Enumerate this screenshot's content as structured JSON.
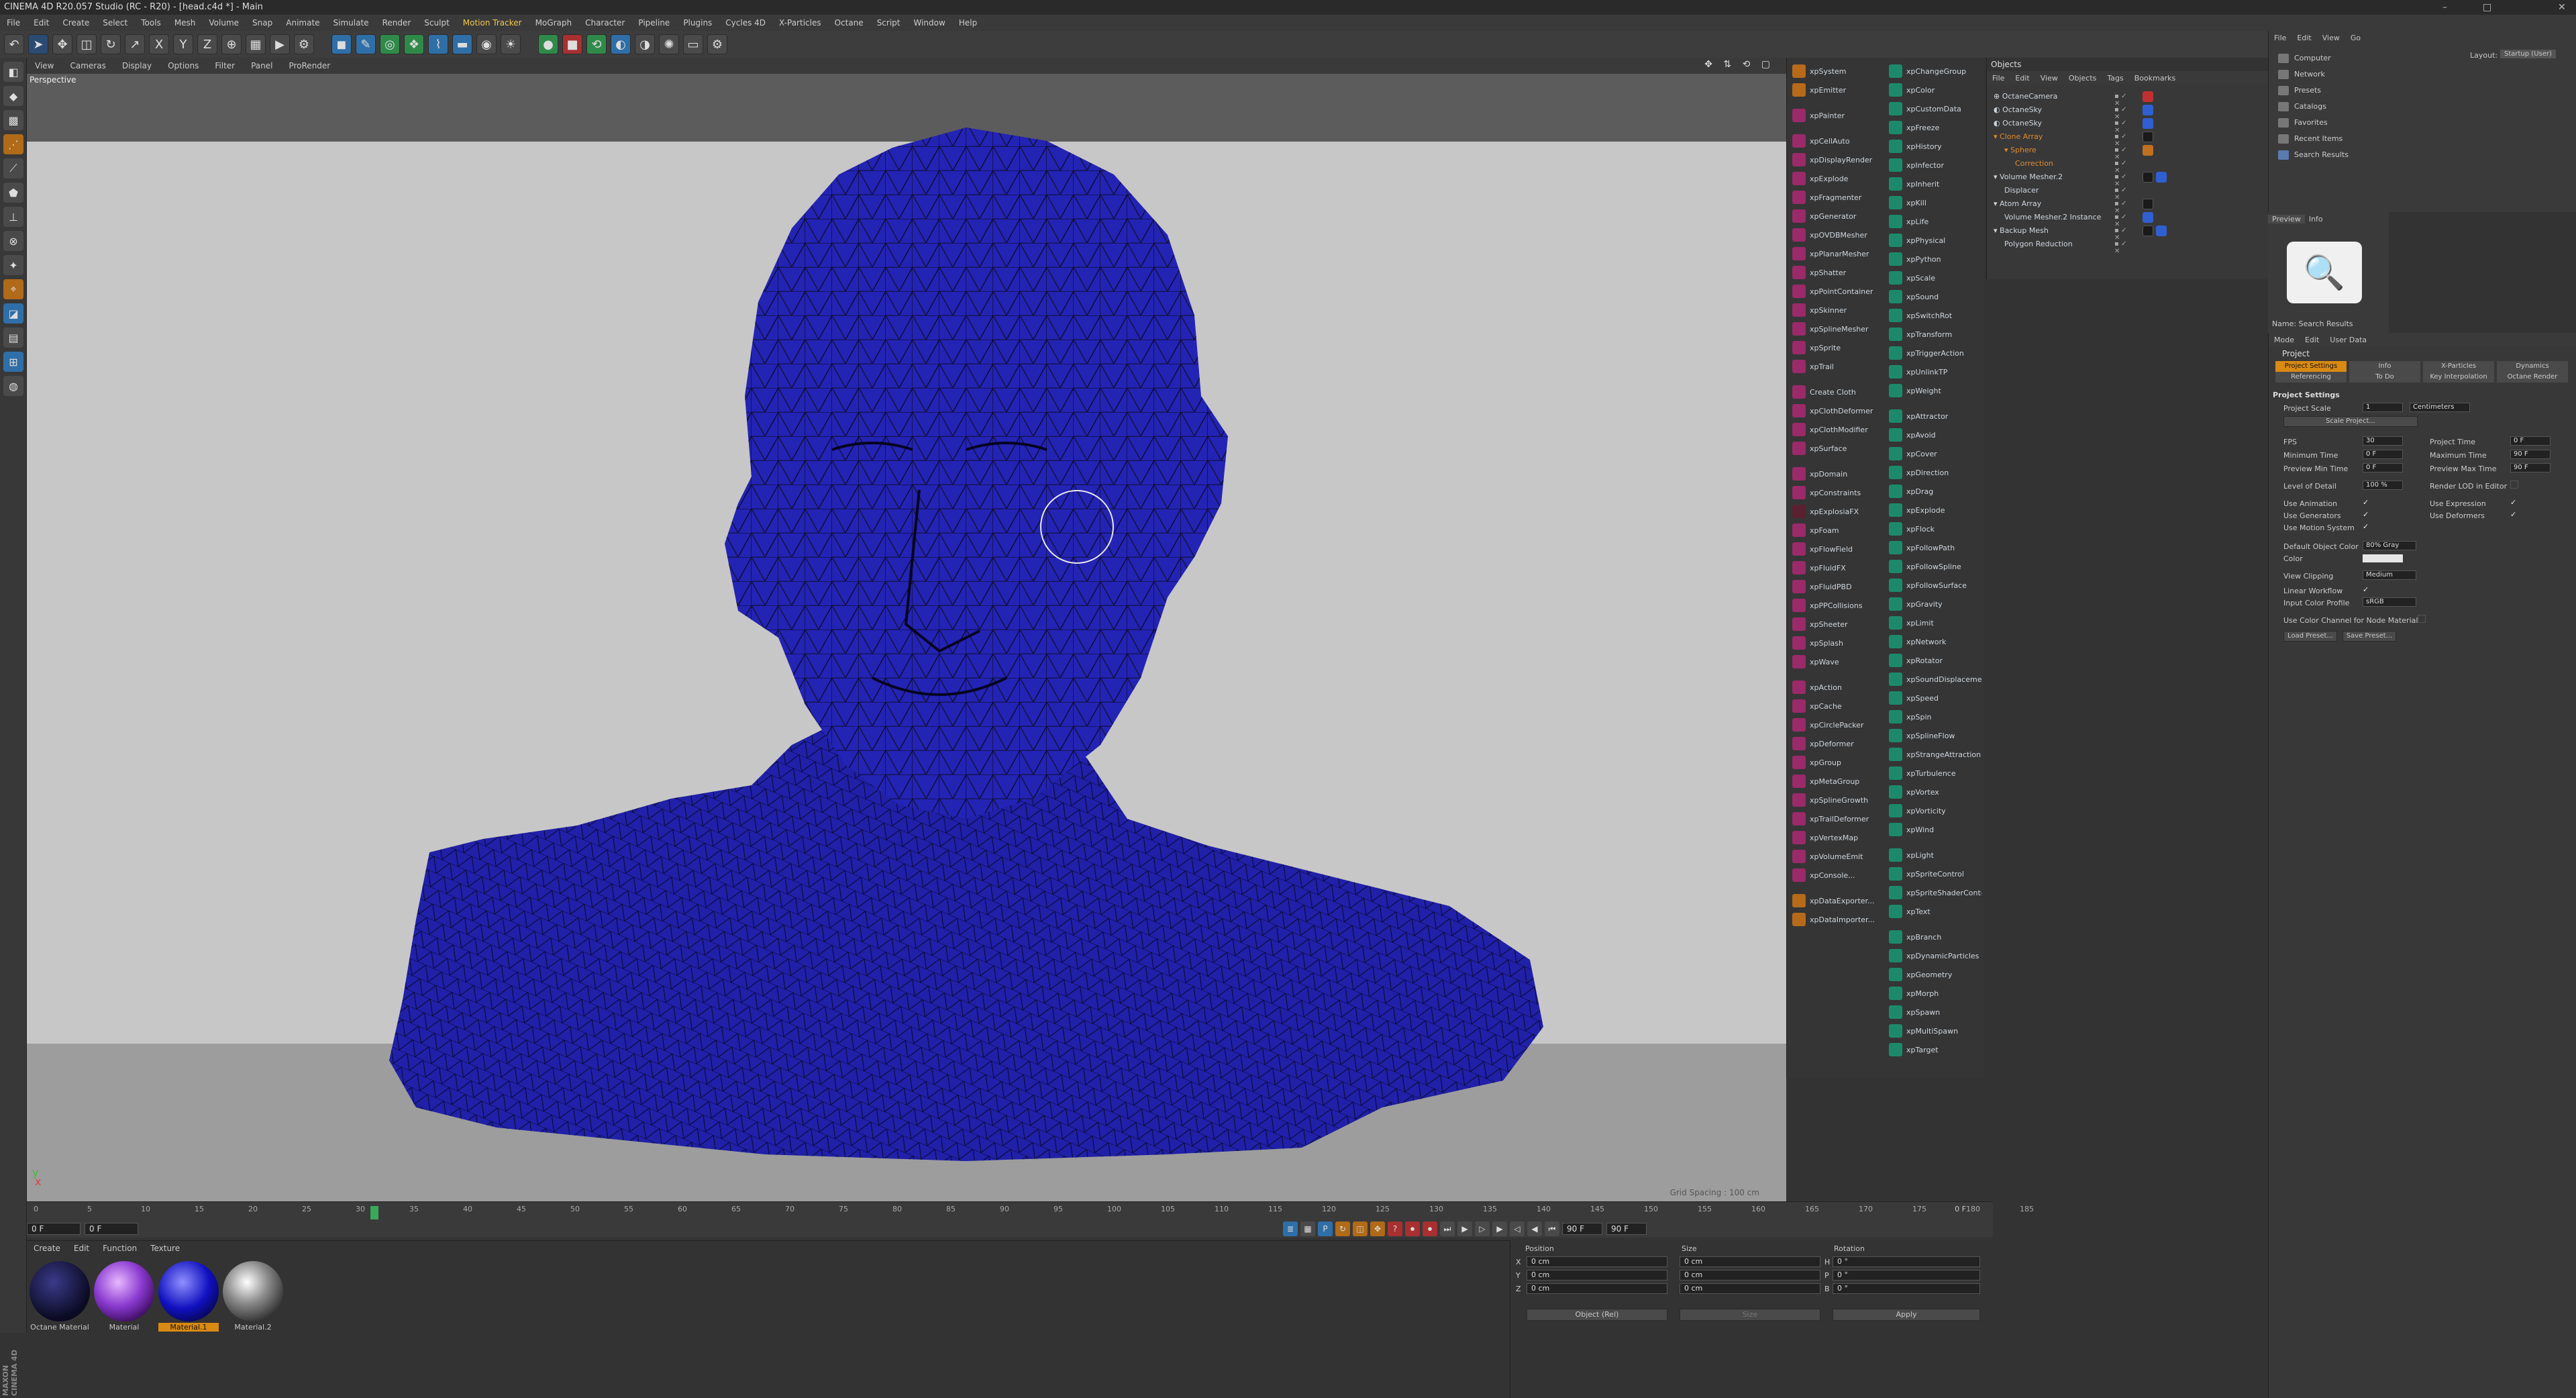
{
  "window": {
    "title": "CINEMA 4D R20.057 Studio (RC - R20) - [head.c4d *] - Main",
    "controls": [
      "–",
      "□",
      "✕"
    ]
  },
  "menu": [
    {
      "label": "File"
    },
    {
      "label": "Edit"
    },
    {
      "label": "Create"
    },
    {
      "label": "Select"
    },
    {
      "label": "Tools"
    },
    {
      "label": "Mesh"
    },
    {
      "label": "Volume"
    },
    {
      "label": "Snap"
    },
    {
      "label": "Animate"
    },
    {
      "label": "Simulate"
    },
    {
      "label": "Render"
    },
    {
      "label": "Sculpt"
    },
    {
      "label": "Motion Tracker",
      "hl": true
    },
    {
      "label": "MoGraph"
    },
    {
      "label": "Character"
    },
    {
      "label": "Pipeline"
    },
    {
      "label": "Plugins"
    },
    {
      "label": "Cycles 4D"
    },
    {
      "label": "X-Particles"
    },
    {
      "label": "Octane"
    },
    {
      "label": "Script"
    },
    {
      "label": "Window"
    },
    {
      "label": "Help"
    }
  ],
  "toolbar": [
    {
      "name": "undo-icon",
      "icon": "↶",
      "c": ""
    },
    {
      "name": "select-arrow-icon",
      "icon": "➤",
      "c": "sel"
    },
    {
      "name": "move-icon",
      "icon": "✥",
      "c": ""
    },
    {
      "name": "scale-icon",
      "icon": "◫",
      "c": ""
    },
    {
      "name": "rotate-icon",
      "icon": "↻",
      "c": ""
    },
    {
      "name": "recent-tool-icon",
      "icon": "↗",
      "c": ""
    },
    {
      "name": "x-axis-icon",
      "icon": "X",
      "c": ""
    },
    {
      "name": "y-axis-icon",
      "icon": "Y",
      "c": ""
    },
    {
      "name": "z-axis-icon",
      "icon": "Z",
      "c": ""
    },
    {
      "name": "coord-system-icon",
      "icon": "⊕",
      "c": ""
    },
    {
      "name": "render-region-icon",
      "icon": "▦",
      "c": ""
    },
    {
      "name": "render-view-icon",
      "icon": "▶",
      "c": ""
    },
    {
      "name": "render-settings-icon",
      "icon": "⚙",
      "c": ""
    },
    {
      "name": "cube-icon",
      "icon": "◼",
      "c": "blue"
    },
    {
      "name": "spline-pen-icon",
      "icon": "✎",
      "c": "blue"
    },
    {
      "name": "nurbs-icon",
      "icon": "◎",
      "c": "green"
    },
    {
      "name": "array-icon",
      "icon": "❖",
      "c": "green"
    },
    {
      "name": "deformer-icon",
      "icon": "⌇",
      "c": "blue"
    },
    {
      "name": "scene-floor-icon",
      "icon": "▬",
      "c": "blue"
    },
    {
      "name": "camera-icon",
      "icon": "◉",
      "c": ""
    },
    {
      "name": "light-icon",
      "icon": "☀",
      "c": ""
    },
    {
      "name": "octane-live-icon",
      "icon": "●",
      "c": "green"
    },
    {
      "name": "octane-stop-icon",
      "icon": "■",
      "c": "red"
    },
    {
      "name": "octane-refresh-icon",
      "icon": "⟲",
      "c": "green"
    },
    {
      "name": "octane-material-icon",
      "icon": "◐",
      "c": "blue"
    },
    {
      "name": "octane-env-icon",
      "icon": "◑",
      "c": ""
    },
    {
      "name": "octane-sun-icon",
      "icon": "✺",
      "c": ""
    },
    {
      "name": "octane-screen-icon",
      "icon": "▭",
      "c": ""
    },
    {
      "name": "octane-settings-icon",
      "icon": "⚙",
      "c": ""
    }
  ],
  "left_tools": [
    {
      "name": "make-editable-icon",
      "icon": "◧",
      "c": ""
    },
    {
      "name": "model-mode-icon",
      "icon": "◆",
      "c": ""
    },
    {
      "name": "texture-mode-icon",
      "icon": "▩",
      "c": ""
    },
    {
      "name": "points-mode-icon",
      "icon": "⋰",
      "c": "orange"
    },
    {
      "name": "edges-mode-icon",
      "icon": "⟋",
      "c": ""
    },
    {
      "name": "polygons-mode-icon",
      "icon": "⬟",
      "c": ""
    },
    {
      "name": "axis-mode-icon",
      "icon": "⊥",
      "c": ""
    },
    {
      "name": "enable-axis-icon",
      "icon": "⊗",
      "c": ""
    },
    {
      "name": "tweak-icon",
      "icon": "✦",
      "c": ""
    },
    {
      "name": "snap-icon",
      "icon": "⌖",
      "c": "orange"
    },
    {
      "name": "workplane-icon",
      "icon": "◪",
      "c": "blue"
    },
    {
      "name": "quantize-icon",
      "icon": "▤",
      "c": ""
    },
    {
      "name": "lock-workplane-icon",
      "icon": "⊞",
      "c": "blue"
    },
    {
      "name": "solo-icon",
      "icon": "◍",
      "c": ""
    }
  ],
  "viewport": {
    "menu": [
      "View",
      "Cameras",
      "Display",
      "Options",
      "Filter",
      "Panel",
      "ProRender"
    ],
    "label": "Perspective",
    "nav": "✥ ⇅ ⟲ ▢",
    "grid_info": "Grid Spacing : 100 cm",
    "axis_x": "x",
    "axis_y": "y"
  },
  "timeline": {
    "ticks": [
      "0",
      "5",
      "10",
      "15",
      "20",
      "25",
      "30",
      "35",
      "40",
      "45",
      "50",
      "55",
      "60",
      "65",
      "70",
      "75",
      "80",
      "85",
      "90",
      "95",
      "100",
      "105",
      "110",
      "115",
      "120",
      "125",
      "130",
      "135",
      "140",
      "145",
      "150",
      "155",
      "160",
      "165",
      "170",
      "175",
      "180",
      "185"
    ],
    "end_label": "0 F",
    "start_field": "0 F",
    "cur_field": "0 F",
    "end_field": "90 F",
    "max_field": "90 F",
    "controls": [
      {
        "name": "goto-start-icon",
        "icon": "⏮",
        "c": ""
      },
      {
        "name": "prev-key-icon",
        "icon": "◀",
        "c": ""
      },
      {
        "name": "prev-frame-icon",
        "icon": "◁",
        "c": ""
      },
      {
        "name": "play-icon",
        "icon": "▶",
        "c": ""
      },
      {
        "name": "next-frame-icon",
        "icon": "▷",
        "c": ""
      },
      {
        "name": "next-key-icon",
        "icon": "▶",
        "c": ""
      },
      {
        "name": "goto-end-icon",
        "icon": "⏭",
        "c": ""
      },
      {
        "name": "record-icon",
        "icon": "⏺",
        "c": "red"
      },
      {
        "name": "autokey-icon",
        "icon": "⏺",
        "c": "red"
      },
      {
        "name": "keyframe-sel-icon",
        "icon": "?",
        "c": "red"
      },
      {
        "name": "pos-key-icon",
        "icon": "✥",
        "c": "orange"
      },
      {
        "name": "scale-key-icon",
        "icon": "◫",
        "c": "orange"
      },
      {
        "name": "rot-key-icon",
        "icon": "↻",
        "c": "orange"
      },
      {
        "name": "param-key-icon",
        "icon": "P",
        "c": "blue"
      },
      {
        "name": "pla-key-icon",
        "icon": "▦",
        "c": ""
      },
      {
        "name": "timeline-icon",
        "icon": "≣",
        "c": "blue"
      }
    ]
  },
  "materials": {
    "menu": [
      "Create",
      "Edit",
      "Function",
      "Texture"
    ],
    "items": [
      {
        "name": "Octane Material",
        "grad": "radial-gradient(circle at 40% 35%,#3a3a8a,#0a0a22 70%)",
        "sel": false
      },
      {
        "name": "Material",
        "grad": "radial-gradient(circle at 40% 35%,#e8b8ff,#8a3ad0 45%,#3a0a5a 80%)",
        "sel": false
      },
      {
        "name": "Material.1",
        "grad": "radial-gradient(circle at 40% 35%,#9090ff,#1010c0 50%,#050540 85%)",
        "sel": true
      },
      {
        "name": "Material.2",
        "grad": "radial-gradient(circle at 40% 35%,#ffffff,#8a8a8a 40%,#2a2a2a 80%)",
        "sel": false
      }
    ]
  },
  "coords": {
    "h_position": "Position",
    "h_size": "Size",
    "h_rotation": "Rotation",
    "rows": [
      {
        "axis": "X",
        "pos": "0 cm",
        "size": "0 cm",
        "rot_label": "H",
        "rot": "0 °"
      },
      {
        "axis": "Y",
        "pos": "0 cm",
        "size": "0 cm",
        "rot_label": "P",
        "rot": "0 °"
      },
      {
        "axis": "Z",
        "pos": "0 cm",
        "size": "0 cm",
        "rot_label": "B",
        "rot": "0 °"
      }
    ],
    "mode": "Object (Rel)",
    "size_mode": "Size",
    "apply": "Apply"
  },
  "xp_col1": [
    {
      "label": "xpSystem",
      "c": "orange"
    },
    {
      "label": "xpEmitter",
      "c": "orange"
    },
    {
      "sep": true
    },
    {
      "label": "xpPainter",
      "c": "pink"
    },
    {
      "sep": true
    },
    {
      "label": "xpCellAuto",
      "c": "pink"
    },
    {
      "label": "xpDisplayRender",
      "c": "pink"
    },
    {
      "label": "xpExplode",
      "c": "pink"
    },
    {
      "label": "xpFragmenter",
      "c": "pink"
    },
    {
      "label": "xpGenerator",
      "c": "pink"
    },
    {
      "label": "xpOVDBMesher",
      "c": "pink"
    },
    {
      "label": "xpPlanarMesher",
      "c": "pink"
    },
    {
      "label": "xpShatter",
      "c": "pink"
    },
    {
      "label": "xpPointContainer",
      "c": "pink"
    },
    {
      "label": "xpSkinner",
      "c": "pink"
    },
    {
      "label": "xpSplineMesher",
      "c": "pink"
    },
    {
      "label": "xpSprite",
      "c": "pink"
    },
    {
      "label": "xpTrail",
      "c": "pink"
    },
    {
      "sep": true
    },
    {
      "label": "Create Cloth",
      "c": "pink"
    },
    {
      "label": "xpClothDeformer",
      "c": "pink"
    },
    {
      "label": "xpClothModifier",
      "c": "pink"
    },
    {
      "label": "xpSurface",
      "c": "pink"
    },
    {
      "sep": true
    },
    {
      "label": "xpDomain",
      "c": "pink"
    },
    {
      "label": "xpConstraints",
      "c": "pink"
    },
    {
      "label": "xpExplosiaFX",
      "c": "dark"
    },
    {
      "label": "xpFoam",
      "c": "pink"
    },
    {
      "label": "xpFlowField",
      "c": "pink"
    },
    {
      "label": "xpFluidFX",
      "c": "pink"
    },
    {
      "label": "xpFluidPBD",
      "c": "pink"
    },
    {
      "label": "xpPPCollisions",
      "c": "pink"
    },
    {
      "label": "xpSheeter",
      "c": "pink"
    },
    {
      "label": "xpSplash",
      "c": "pink"
    },
    {
      "label": "xpWave",
      "c": "pink"
    },
    {
      "sep": true
    },
    {
      "label": "xpAction",
      "c": "pink"
    },
    {
      "label": "xpCache",
      "c": "pink"
    },
    {
      "label": "xpCirclePacker",
      "c": "pink"
    },
    {
      "label": "xpDeformer",
      "c": "pink"
    },
    {
      "label": "xpGroup",
      "c": "pink"
    },
    {
      "label": "xpMetaGroup",
      "c": "pink"
    },
    {
      "label": "xpSplineGrowth",
      "c": "pink"
    },
    {
      "label": "xpTrailDeformer",
      "c": "pink"
    },
    {
      "label": "xpVertexMap",
      "c": "pink"
    },
    {
      "label": "xpVolumeEmit",
      "c": "pink"
    },
    {
      "label": "xpConsole...",
      "c": "pink"
    },
    {
      "sep": true
    },
    {
      "label": "xpDataExporter...",
      "c": "orange"
    },
    {
      "label": "xpDataImporter...",
      "c": "orange"
    }
  ],
  "xp_col2": [
    {
      "label": "xpChangeGroup",
      "c": "teal"
    },
    {
      "label": "xpColor",
      "c": "teal"
    },
    {
      "label": "xpCustomData",
      "c": "teal"
    },
    {
      "label": "xpFreeze",
      "c": "teal"
    },
    {
      "label": "xpHistory",
      "c": "teal"
    },
    {
      "label": "xpInfector",
      "c": "teal"
    },
    {
      "label": "xpInherit",
      "c": "teal"
    },
    {
      "label": "xpKill",
      "c": "teal"
    },
    {
      "label": "xpLife",
      "c": "teal"
    },
    {
      "label": "xpPhysical",
      "c": "teal"
    },
    {
      "label": "xpPython",
      "c": "teal"
    },
    {
      "label": "xpScale",
      "c": "teal"
    },
    {
      "label": "xpSound",
      "c": "teal"
    },
    {
      "label": "xpSwitchRot",
      "c": "teal"
    },
    {
      "label": "xpTransform",
      "c": "teal"
    },
    {
      "label": "xpTriggerAction",
      "c": "teal"
    },
    {
      "label": "xpUnlinkTP",
      "c": "teal"
    },
    {
      "label": "xpWeight",
      "c": "teal"
    },
    {
      "sep": true
    },
    {
      "label": "xpAttractor",
      "c": "teal"
    },
    {
      "label": "xpAvoid",
      "c": "teal"
    },
    {
      "label": "xpCover",
      "c": "teal"
    },
    {
      "label": "xpDirection",
      "c": "teal"
    },
    {
      "label": "xpDrag",
      "c": "teal"
    },
    {
      "label": "xpExplode",
      "c": "teal"
    },
    {
      "label": "xpFlock",
      "c": "teal"
    },
    {
      "label": "xpFollowPath",
      "c": "teal"
    },
    {
      "label": "xpFollowSpline",
      "c": "teal"
    },
    {
      "label": "xpFollowSurface",
      "c": "teal"
    },
    {
      "label": "xpGravity",
      "c": "teal"
    },
    {
      "label": "xpLimit",
      "c": "teal"
    },
    {
      "label": "xpNetwork",
      "c": "teal"
    },
    {
      "label": "xpRotator",
      "c": "teal"
    },
    {
      "label": "xpSoundDisplacement",
      "c": "teal"
    },
    {
      "label": "xpSpeed",
      "c": "teal"
    },
    {
      "label": "xpSpin",
      "c": "teal"
    },
    {
      "label": "xpSplineFlow",
      "c": "teal"
    },
    {
      "label": "xpStrangeAttraction",
      "c": "teal"
    },
    {
      "label": "xpTurbulence",
      "c": "teal"
    },
    {
      "label": "xpVortex",
      "c": "teal"
    },
    {
      "label": "xpVorticity",
      "c": "teal"
    },
    {
      "label": "xpWind",
      "c": "teal"
    },
    {
      "sep": true
    },
    {
      "label": "xpLight",
      "c": "teal"
    },
    {
      "label": "xpSpriteControl",
      "c": "teal"
    },
    {
      "label": "xpSpriteShaderControl",
      "c": "teal"
    },
    {
      "label": "xpText",
      "c": "teal"
    },
    {
      "sep": true
    },
    {
      "label": "xpBranch",
      "c": "teal"
    },
    {
      "label": "xpDynamicParticles",
      "c": "teal"
    },
    {
      "label": "xpGeometry",
      "c": "teal"
    },
    {
      "label": "xpMorph",
      "c": "teal"
    },
    {
      "label": "xpSpawn",
      "c": "teal"
    },
    {
      "label": "xpMultiSpawn",
      "c": "teal"
    },
    {
      "label": "xpTarget",
      "c": "teal"
    }
  ],
  "objects": {
    "header": "Objects",
    "menu": [
      "File",
      "Edit",
      "View",
      "Objects",
      "Tags",
      "Bookmarks"
    ],
    "items": [
      {
        "label": "⊕ OctaneCamera",
        "indent": 0,
        "orange": false,
        "vis": "▪ ✓ ✕",
        "tags": [
          "red"
        ]
      },
      {
        "label": "◐ OctaneSky",
        "indent": 0,
        "orange": false,
        "vis": "▪ ✓ ✕",
        "tags": [
          "blue"
        ]
      },
      {
        "label": "◐ OctaneSky",
        "indent": 0,
        "orange": false,
        "vis": "▪ ✓ ✕",
        "tags": [
          "blue"
        ]
      },
      {
        "label": "▾ Clone Array",
        "indent": 0,
        "orange": true,
        "vis": "▪ ✓ ✕",
        "tags": [
          "dark"
        ]
      },
      {
        "label": "▾ Sphere",
        "indent": 1,
        "orange": true,
        "vis": "▪ ✓ ✕",
        "tags": [
          "orange"
        ]
      },
      {
        "label": "Correction",
        "indent": 2,
        "orange": true,
        "vis": "▪ ✓ ✕",
        "tags": []
      },
      {
        "label": "▾ Volume Mesher.2",
        "indent": 0,
        "orange": false,
        "vis": "▪ ✓ ✕",
        "tags": [
          "dark",
          "blue"
        ]
      },
      {
        "label": "Displacer",
        "indent": 1,
        "orange": false,
        "vis": "▪ ✓ ✕",
        "tags": []
      },
      {
        "label": "▾ Atom Array",
        "indent": 0,
        "orange": false,
        "vis": "▪ ✓ ✕",
        "tags": [
          "dark"
        ]
      },
      {
        "label": "Volume Mesher.2 Instance",
        "indent": 1,
        "orange": false,
        "vis": "▪ ✓ ✕",
        "tags": [
          "blue"
        ]
      },
      {
        "label": "▾ Backup Mesh",
        "indent": 0,
        "orange": false,
        "vis": "▪ ✓ ✕",
        "tags": [
          "dark",
          "blue"
        ]
      },
      {
        "label": "Polygon Reduction",
        "indent": 1,
        "orange": false,
        "vis": "▪ ✓ ✕",
        "tags": []
      }
    ]
  },
  "content_browser": {
    "menu": [
      "File",
      "Edit",
      "View",
      "Go"
    ],
    "layout_label": "Layout:",
    "layout_value": "Startup (User)",
    "items": [
      {
        "label": "Computer",
        "sel": false
      },
      {
        "label": "Network",
        "sel": false
      },
      {
        "label": "Presets",
        "sel": false
      },
      {
        "label": "Catalogs",
        "sel": false
      },
      {
        "label": "Favorites",
        "sel": false
      },
      {
        "label": "Recent Items",
        "sel": false
      },
      {
        "label": "Search Results",
        "sel": true
      }
    ]
  },
  "preview": {
    "tabs": [
      "Preview",
      "Info"
    ],
    "name": "Name: Search Results"
  },
  "attributes": {
    "menu": [
      "Mode",
      "Edit",
      "User Data"
    ],
    "title": "Project",
    "tabs_row1": [
      {
        "label": "Project Settings",
        "act": true
      },
      {
        "label": "Info",
        "act": false
      },
      {
        "label": "X-Particles",
        "act": false
      },
      {
        "label": "Dynamics",
        "act": false
      }
    ],
    "tabs_row2": [
      {
        "label": "Referencing",
        "act": false
      },
      {
        "label": "To Do",
        "act": false
      },
      {
        "label": "Key Interpolation",
        "act": false
      },
      {
        "label": "Octane Render",
        "act": false
      }
    ],
    "section": "Project Settings",
    "project_scale_label": "Project Scale",
    "project_scale_value": "1",
    "project_scale_unit": "Centimeters",
    "scale_project_btn": "Scale Project...",
    "fps_label": "FPS",
    "fps": "30",
    "project_time_label": "Project Time",
    "project_time": "0 F",
    "min_time_label": "Minimum Time",
    "min_time": "0 F",
    "max_time_label": "Maximum Time",
    "max_time": "90 F",
    "prev_min_label": "Preview Min Time",
    "prev_min": "0 F",
    "prev_max_label": "Preview Max Time",
    "prev_max": "90 F",
    "lod_label": "Level of Detail",
    "lod": "100 %",
    "render_lod_label": "Render LOD in Editor",
    "use_anim_label": "Use Animation",
    "use_expr_label": "Use Expression",
    "use_gen_label": "Use Generators",
    "use_def_label": "Use Deformers",
    "use_motion_label": "Use Motion System",
    "check": "✓",
    "default_color_label": "Default Object Color",
    "default_color": "80% Gray",
    "color_label": "Color",
    "view_clip_label": "View Clipping",
    "view_clip": "Medium",
    "linear_label": "Linear Workflow",
    "input_profile_label": "Input Color Profile",
    "input_profile": "sRGB",
    "use_color_channel_label": "Use Color Channel for Node Material",
    "load_preset": "Load Preset...",
    "save_preset": "Save Preset..."
  },
  "brand": "MAXON CINEMA 4D"
}
